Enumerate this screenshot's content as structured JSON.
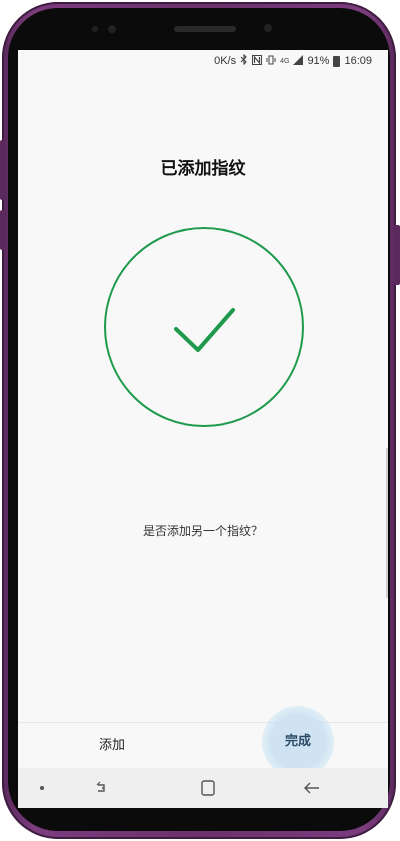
{
  "status_bar": {
    "net_speed": "0K/s",
    "bluetooth_icon": "bluetooth-icon",
    "nfc_icon": "nfc-icon",
    "vibrate_icon": "vibrate-icon",
    "signal_label": "4G",
    "signal_icon": "signal-icon",
    "battery_percent": "91%",
    "battery_icon": "battery-icon",
    "time": "16:09"
  },
  "page": {
    "title": "已添加指纹",
    "success_icon": "checkmark-icon",
    "question": "是否添加另一个指纹？"
  },
  "actions": {
    "add_label": "添加",
    "done_label": "完成"
  },
  "nav_bar": {
    "items": [
      "dot-icon",
      "recents-icon",
      "home-icon",
      "back-icon"
    ]
  },
  "colors": {
    "accent_green": "#1f9a4c",
    "phone_frame": "#6b316c",
    "screen_bg": "#f8f8f8",
    "done_highlight": "#cfe3f2"
  }
}
